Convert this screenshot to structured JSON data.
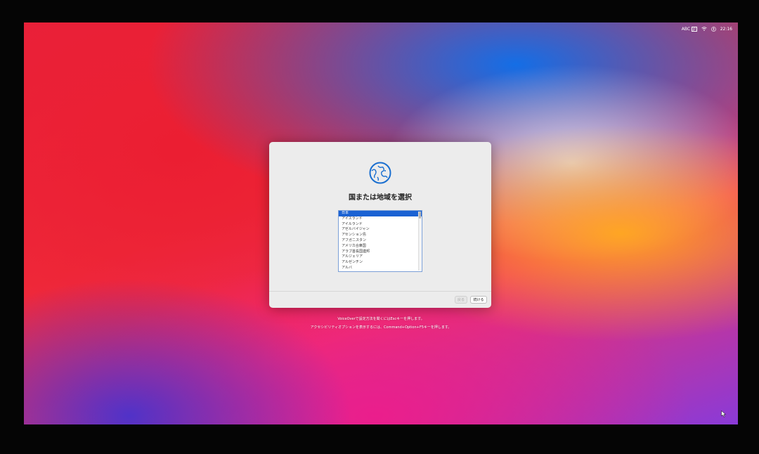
{
  "menubar": {
    "input_source": "ABC",
    "input_badge": "JP",
    "clock": "22:16"
  },
  "dialog": {
    "title": "国または地域を選択",
    "regions": [
      "日本",
      "アイスランド",
      "アイルランド",
      "アゼルバイジャン",
      "アセンション島",
      "アフガニスタン",
      "アメリカ合衆国",
      "アラブ首長国連邦",
      "アルジェリア",
      "アルゼンチン",
      "アルバ"
    ],
    "selected_index": 0,
    "back_label": "戻る",
    "continue_label": "続ける"
  },
  "hints": {
    "voiceover": "VoiceOverで設定方法を聞くにはEscキーを押します。",
    "accessibility": "アクセシビリティオプションを表示するには、Command+Option+F5キーを押します。"
  },
  "colors": {
    "accent": "#1a62d3",
    "globe": "#1a6fd0"
  }
}
